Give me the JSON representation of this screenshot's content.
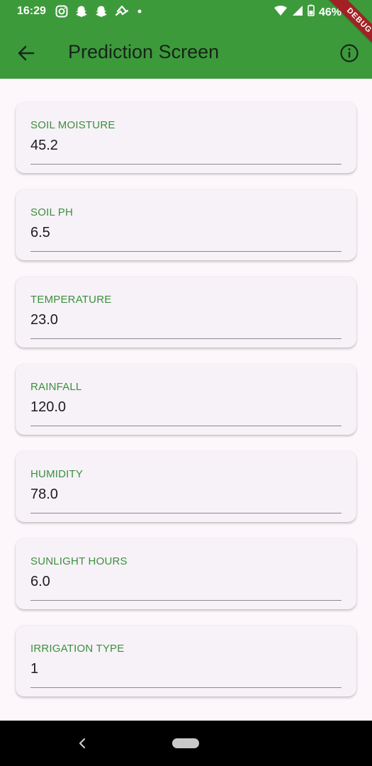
{
  "status_bar": {
    "time": "16:29",
    "battery": "46%",
    "icons": [
      "instagram-icon",
      "snapchat-icon",
      "snapchat-icon",
      "app-notification-icon",
      "dot-icon",
      "wifi-icon",
      "signal-icon",
      "battery-icon"
    ]
  },
  "app_bar": {
    "title": "Prediction Screen",
    "back_icon": "arrow-back-icon",
    "info_icon": "info-icon",
    "debug_label": "DEBUG",
    "background": "#3c9a3b"
  },
  "fields": [
    {
      "label": "SOIL MOISTURE",
      "value": "45.2"
    },
    {
      "label": "SOIL PH",
      "value": "6.5"
    },
    {
      "label": "TEMPERATURE",
      "value": "23.0"
    },
    {
      "label": "RAINFALL",
      "value": "120.0"
    },
    {
      "label": "HUMIDITY",
      "value": "78.0"
    },
    {
      "label": "SUNLIGHT HOURS",
      "value": "6.0"
    },
    {
      "label": "IRRIGATION TYPE",
      "value": "1"
    }
  ],
  "colors": {
    "accent": "#3a913a",
    "card_bg": "#f7f1f8",
    "page_bg": "#fdf7fb"
  }
}
